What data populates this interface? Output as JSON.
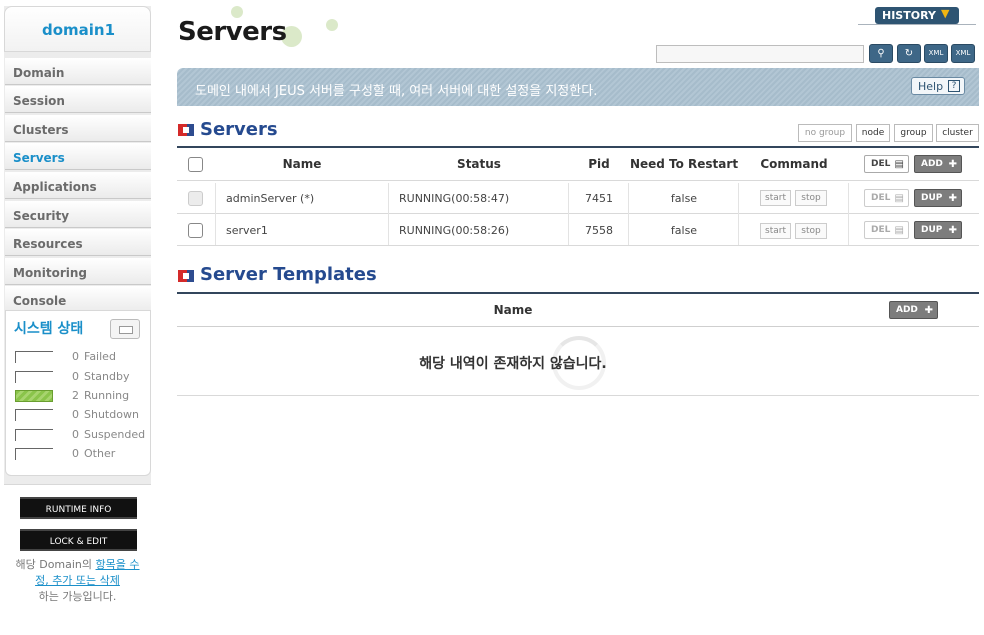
{
  "sidebar": {
    "domain": "domain1",
    "nav": [
      {
        "label": "Domain",
        "active": false
      },
      {
        "label": "Session",
        "active": false
      },
      {
        "label": "Clusters",
        "active": false
      },
      {
        "label": "Servers",
        "active": true
      },
      {
        "label": "Applications",
        "active": false
      },
      {
        "label": "Security",
        "active": false
      },
      {
        "label": "Resources",
        "active": false
      },
      {
        "label": "Monitoring",
        "active": false
      },
      {
        "label": "Console",
        "active": false
      }
    ],
    "system_status": {
      "title": "시스템 상태",
      "rows": [
        {
          "count": "0",
          "label": "Failed"
        },
        {
          "count": "0",
          "label": "Standby"
        },
        {
          "count": "2",
          "label": "Running"
        },
        {
          "count": "0",
          "label": "Shutdown"
        },
        {
          "count": "0",
          "label": "Suspended"
        },
        {
          "count": "0",
          "label": "Other"
        }
      ]
    },
    "runtime_info": "RUNTIME INFO",
    "lock_edit": "LOCK & EDIT",
    "note_prefix": "해당 Domain의 ",
    "note_link": "항목을 수정, 추가 또는 삭제",
    "note_suffix": "하는 가능입니다."
  },
  "header": {
    "title": "Servers",
    "history": "HISTORY",
    "search_value": "",
    "description": "도메인 내에서 JEUS 서버를 구성할 때, 여러 서버에 대한 설정을 지정한다.",
    "help": "Help",
    "icons": [
      "search-icon",
      "refresh-icon",
      "xml-export-icon",
      "xml-import-icon"
    ]
  },
  "servers": {
    "title": "Servers",
    "filters": [
      "no group",
      "node",
      "group",
      "cluster"
    ],
    "columns": {
      "name": "Name",
      "status": "Status",
      "pid": "Pid",
      "restart": "Need To Restart",
      "command": "Command"
    },
    "del": "DEL",
    "add": "ADD",
    "dup": "DUP",
    "start": "start",
    "stop": "stop",
    "rows": [
      {
        "name": "adminServer (*)",
        "status": "RUNNING(00:58:47)",
        "pid": "7451",
        "restart": "false"
      },
      {
        "name": "server1",
        "status": "RUNNING(00:58:26)",
        "pid": "7558",
        "restart": "false"
      }
    ]
  },
  "templates": {
    "title": "Server Templates",
    "column_name": "Name",
    "add": "ADD",
    "empty": "해당 내역이 존재하지 않습니다."
  }
}
